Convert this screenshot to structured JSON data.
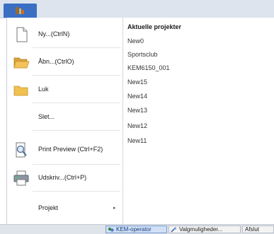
{
  "app": {
    "logo_icon": "kem-app-logo-icon",
    "accent": "#3a6fc4"
  },
  "menu": {
    "items": [
      {
        "label": "Ny...(CtrlN)",
        "icon": "new-document-icon"
      },
      {
        "label": "Åbn...(CtrlO)",
        "icon": "open-folder-icon"
      },
      {
        "label": "Luk",
        "icon": "close-folder-icon"
      },
      {
        "label": "Slet...",
        "icon": ""
      },
      {
        "label": "Print Preview (Ctrl+F2)",
        "icon": "print-preview-icon"
      },
      {
        "label": "Udskriv...(Ctrl+P)",
        "icon": "printer-icon"
      },
      {
        "label": "Projekt",
        "icon": "",
        "submenu": true
      }
    ]
  },
  "recent": {
    "title": "Aktuelle projekter",
    "projects": [
      "New0",
      "Sportsclub",
      "KEM6150_001",
      "New15",
      "New14",
      "New13",
      "New12",
      "New11"
    ]
  },
  "statusbar": {
    "items": [
      "KEM-operator",
      "Valgmuligheder...",
      "Afslut"
    ]
  }
}
